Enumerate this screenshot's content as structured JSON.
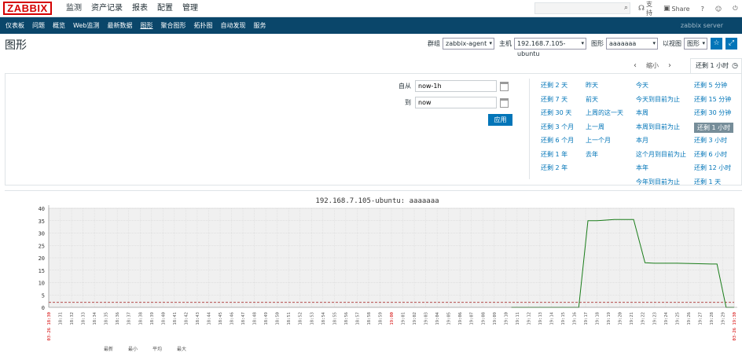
{
  "header": {
    "logo": "ZABBIX",
    "menu": [
      "监测",
      "资产记录",
      "报表",
      "配置",
      "管理"
    ],
    "active_menu": "监测",
    "search_placeholder": "",
    "support": "支持",
    "share": "Share",
    "help": "?"
  },
  "submenu": {
    "items": [
      "仪表板",
      "问题",
      "概览",
      "Web监测",
      "最新数据",
      "图形",
      "聚合图形",
      "拓扑图",
      "自动发现",
      "服务"
    ],
    "active": "图形",
    "server": "zabbix server"
  },
  "page": {
    "title": "图形",
    "filters": {
      "group_label": "群组",
      "group_value": "zabbix-agent",
      "host_label": "主机",
      "host_value": "192.168.7.105-ubuntu",
      "graph_label": "图形",
      "graph_value": "aaaaaaa",
      "view_label": "以视图",
      "view_value": "图形"
    }
  },
  "timebar": {
    "zoom_out": "缩小",
    "active_tab": "还剩 1 小时"
  },
  "timepanel": {
    "from_label": "自从",
    "from_value": "now-1h",
    "to_label": "到",
    "to_value": "now",
    "apply_label": "应用",
    "quick": [
      [
        "还剩 2 天",
        "还剩 7 天",
        "还剩 30 天",
        "还剩 3 个月",
        "还剩 6 个月",
        "还剩 1 年",
        "还剩 2 年"
      ],
      [
        "昨天",
        "前天",
        "上周的这一天",
        "上一周",
        "上一个月",
        "去年"
      ],
      [
        "今天",
        "今天到目前为止",
        "本周",
        "本周到目前为止",
        "本月",
        "这个月到目前为止",
        "本年",
        "今年到目前为止"
      ],
      [
        "还剩 5 分钟",
        "还剩 15 分钟",
        "还剩 30 分钟",
        "还剩 1 小时",
        "还剩 3 小时",
        "还剩 6 小时",
        "还剩 12 小时",
        "还剩 1 天"
      ]
    ],
    "selected": "还剩 1 小时"
  },
  "chart_data": {
    "type": "line",
    "title": "192.168.7.105-ubuntu: aaaaaaa",
    "ylim": [
      0,
      40
    ],
    "yticks": [
      0,
      5,
      10,
      15,
      20,
      25,
      30,
      35,
      40
    ],
    "x_start_label": "03-26 18:30",
    "x_end_label": "03-26 19:30",
    "x_tick_labels": [
      "18:31",
      "18:32",
      "18:33",
      "18:34",
      "18:35",
      "18:36",
      "18:37",
      "18:38",
      "18:39",
      "18:40",
      "18:41",
      "18:42",
      "18:43",
      "18:44",
      "18:45",
      "18:46",
      "18:47",
      "18:48",
      "18:49",
      "18:50",
      "18:51",
      "18:52",
      "18:53",
      "18:54",
      "18:55",
      "18:56",
      "18:57",
      "18:58",
      "18:59",
      "19:00",
      "19:01",
      "19:02",
      "19:03",
      "19:04",
      "19:05",
      "19:06",
      "19:07",
      "19:08",
      "19:09",
      "19:10",
      "19:11",
      "19:12",
      "19:13",
      "19:14",
      "19:15",
      "19:16",
      "19:17",
      "19:18",
      "19:19",
      "19:20",
      "19:21",
      "19:22",
      "19:23",
      "19:24",
      "19:25",
      "19:26",
      "19:27",
      "19:28",
      "19:29"
    ],
    "highlight_tick": "19:00",
    "series": [
      {
        "color": "#1a7d1a",
        "points": [
          [
            40.5,
            0
          ],
          [
            46.4,
            0
          ],
          [
            47.2,
            35
          ],
          [
            48,
            35
          ],
          [
            49.5,
            35.5
          ],
          [
            50.5,
            35.5
          ],
          [
            51.2,
            35.5
          ],
          [
            52.2,
            18
          ],
          [
            53,
            17.8
          ],
          [
            55,
            17.8
          ],
          [
            58,
            17.5
          ],
          [
            58.5,
            17.5
          ],
          [
            59.3,
            0
          ],
          [
            60,
            0
          ]
        ]
      }
    ],
    "threshold": {
      "value": 2,
      "color": "#a33"
    },
    "legend_headers": [
      "最新",
      "最小",
      "平均",
      "最大"
    ]
  }
}
